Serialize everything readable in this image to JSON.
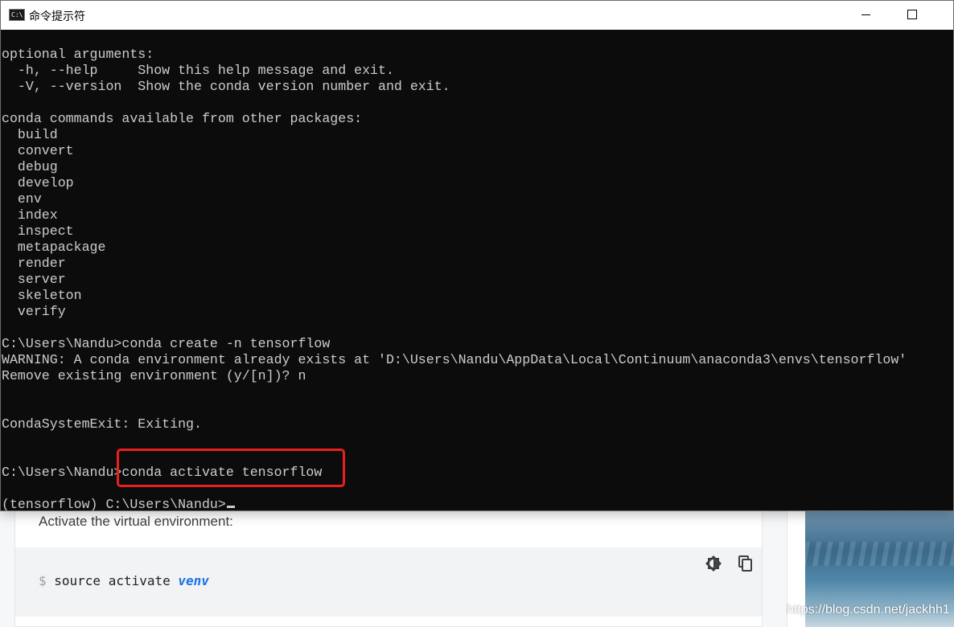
{
  "window": {
    "title": "命令提示符",
    "icon_text": "C:\\."
  },
  "console": {
    "lines": [
      "optional arguments:",
      "  -h, --help     Show this help message and exit.",
      "  -V, --version  Show the conda version number and exit.",
      "",
      "conda commands available from other packages:",
      "  build",
      "  convert",
      "  debug",
      "  develop",
      "  env",
      "  index",
      "  inspect",
      "  metapackage",
      "  render",
      "  server",
      "  skeleton",
      "  verify",
      "",
      "C:\\Users\\Nandu>conda create -n tensorflow",
      "WARNING: A conda environment already exists at 'D:\\Users\\Nandu\\AppData\\Local\\Continuum\\anaconda3\\envs\\tensorflow'",
      "Remove existing environment (y/[n])? n",
      "",
      "",
      "CondaSystemExit: Exiting.",
      "",
      "",
      "C:\\Users\\Nandu>conda activate tensorflow",
      "",
      "(tensorflow) C:\\Users\\Nandu>"
    ],
    "highlight_color": "#e8201c"
  },
  "doc": {
    "instruction": "Activate the virtual environment:",
    "code_prompt": "$ ",
    "code_command": "source activate ",
    "code_arg": "venv"
  },
  "watermark": "https://blog.csdn.net/jackhh1",
  "colors": {
    "console_bg": "#0c0c0c",
    "console_fg": "#cccccc",
    "code_arg": "#1a73e8"
  }
}
